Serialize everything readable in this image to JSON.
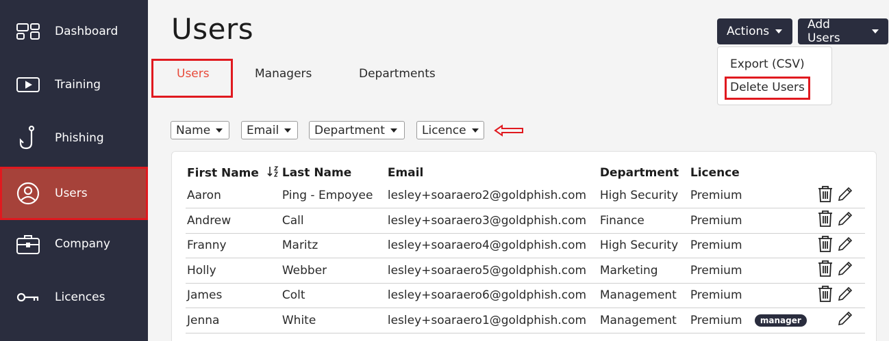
{
  "sidebar": {
    "items": [
      {
        "label": "Dashboard",
        "icon": "dashboard-icon"
      },
      {
        "label": "Training",
        "icon": "play-icon"
      },
      {
        "label": "Phishing",
        "icon": "hook-icon"
      },
      {
        "label": "Users",
        "icon": "user-icon",
        "active": true
      },
      {
        "label": "Company",
        "icon": "briefcase-icon"
      },
      {
        "label": "Licences",
        "icon": "key-icon"
      }
    ]
  },
  "header": {
    "title": "Users",
    "actions_label": "Actions",
    "add_users_label": "Add Users"
  },
  "actions_menu": {
    "items": [
      "Export (CSV)",
      "Delete Users"
    ]
  },
  "tabs": [
    {
      "label": "Users",
      "active": true
    },
    {
      "label": "Managers"
    },
    {
      "label": "Departments"
    }
  ],
  "filters": [
    "Name",
    "Email",
    "Department",
    "Licence"
  ],
  "table": {
    "columns": [
      "First Name",
      "Last Name",
      "Email",
      "Department",
      "Licence"
    ],
    "rows": [
      {
        "first": "Aaron",
        "last": "Ping - Empoyee",
        "email": "lesley+soaraero2@goldphish.com",
        "dept": "High Security",
        "licence": "Premium"
      },
      {
        "first": "Andrew",
        "last": "Call",
        "email": "lesley+soaraero3@goldphish.com",
        "dept": "Finance",
        "licence": "Premium"
      },
      {
        "first": "Franny",
        "last": "Maritz",
        "email": "lesley+soaraero4@goldphish.com",
        "dept": "High Security",
        "licence": "Premium"
      },
      {
        "first": "Holly",
        "last": "Webber",
        "email": "lesley+soaraero5@goldphish.com",
        "dept": "Marketing",
        "licence": "Premium"
      },
      {
        "first": "James",
        "last": "Colt",
        "email": "lesley+soaraero6@goldphish.com",
        "dept": "Management",
        "licence": "Premium"
      },
      {
        "first": "Jenna",
        "last": "White",
        "email": "lesley+soaraero1@goldphish.com",
        "dept": "Management",
        "licence": "Premium",
        "badge": "manager"
      }
    ]
  },
  "colors": {
    "sidebar": "#2a2d3e",
    "active_nav": "#a6423a",
    "highlight": "#e0191f",
    "active_tab": "#e84a3a"
  }
}
